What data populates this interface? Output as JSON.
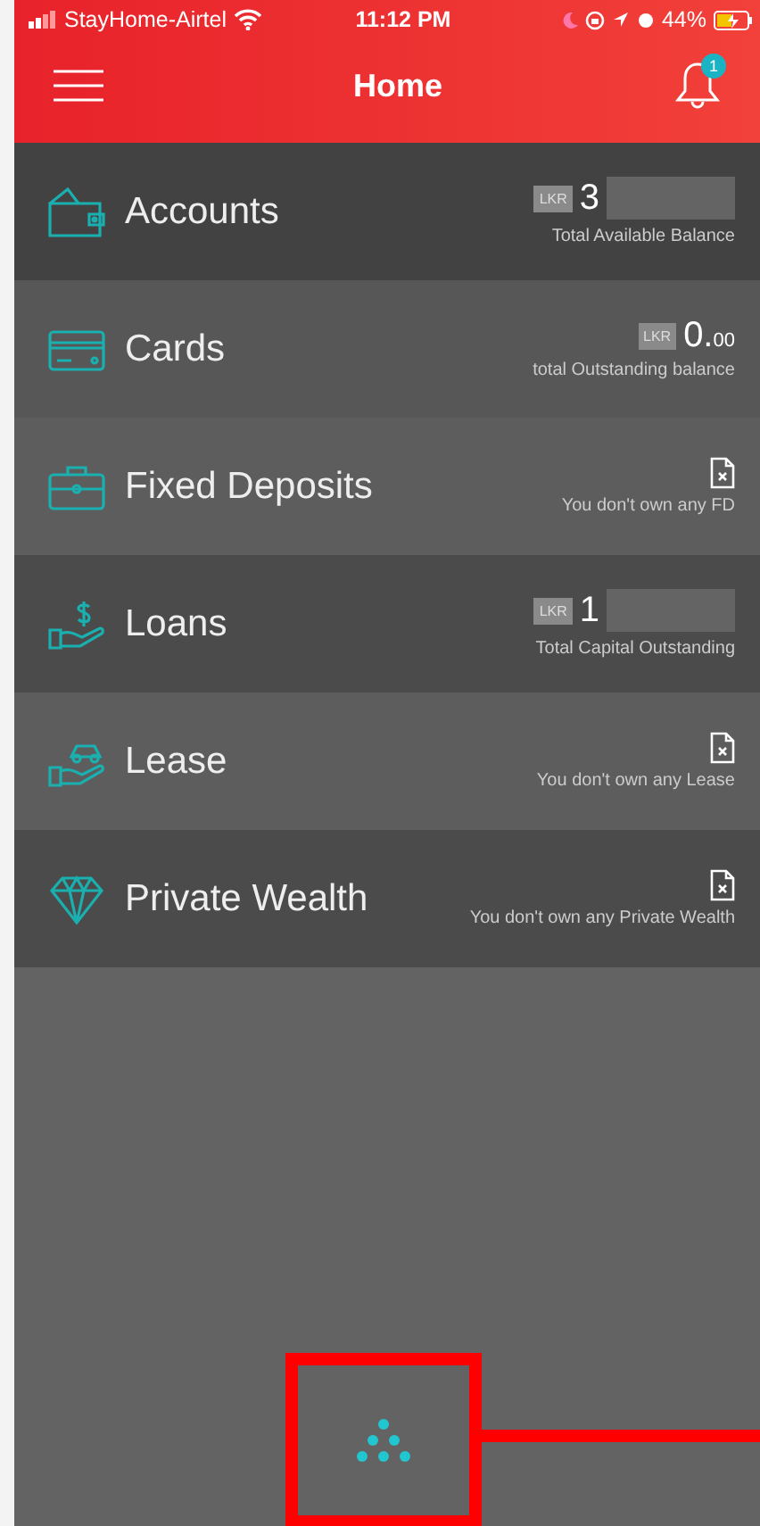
{
  "status_bar": {
    "carrier": "StayHome-Airtel",
    "time": "11:12 PM",
    "battery": "44%"
  },
  "header": {
    "title": "Home",
    "notification_count": "1"
  },
  "rows": [
    {
      "kind": "amount",
      "label": "Accounts",
      "currency": "LKR",
      "amount": "3",
      "caption": "Total Available Balance",
      "redacted": true
    },
    {
      "kind": "amount",
      "label": "Cards",
      "currency": "LKR",
      "amount": "0.",
      "decimals": "00",
      "caption": "total Outstanding balance",
      "redacted": false
    },
    {
      "kind": "empty",
      "label": "Fixed Deposits",
      "caption": "You don't own any FD"
    },
    {
      "kind": "amount",
      "label": "Loans",
      "currency": "LKR",
      "amount": "1",
      "caption": "Total Capital Outstanding",
      "redacted": true
    },
    {
      "kind": "empty",
      "label": "Lease",
      "caption": "You don't own any Lease"
    },
    {
      "kind": "empty",
      "label": "Private Wealth",
      "caption": "You don't own any Private Wealth"
    }
  ]
}
